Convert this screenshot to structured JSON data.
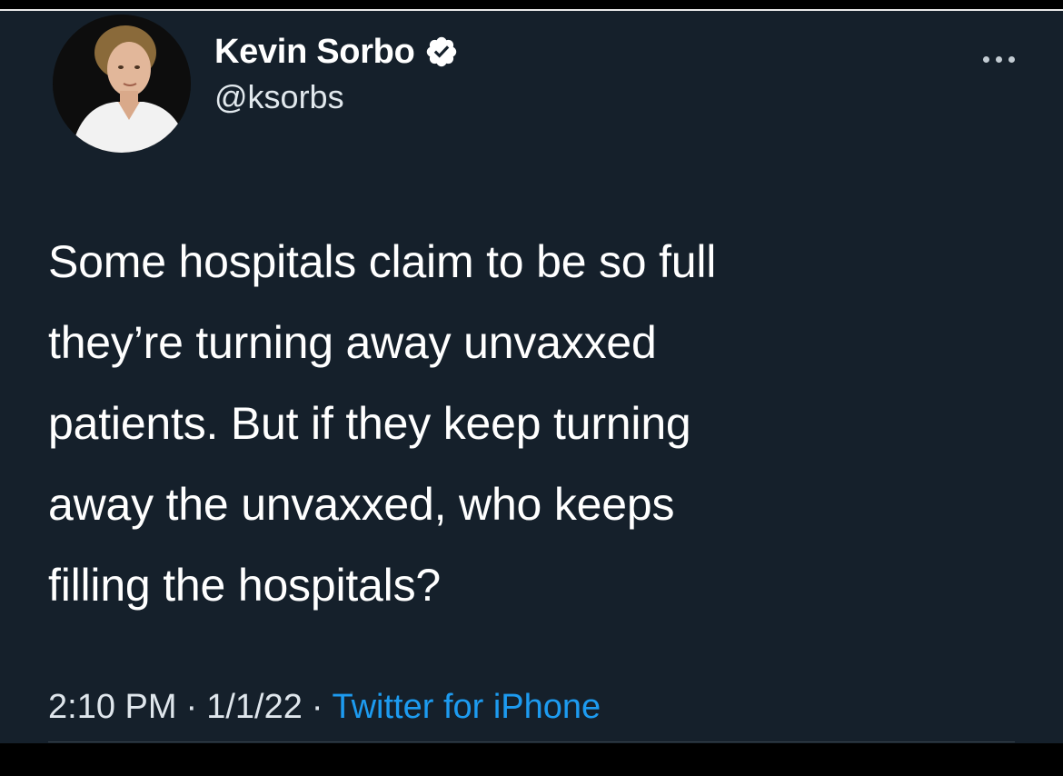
{
  "tweet": {
    "display_name": "Kevin Sorbo",
    "handle": "@ksorbs",
    "verified": true,
    "text": "Some hospitals claim to be so full\nthey’re turning away unvaxxed\npatients. But if they keep turning\naway the unvaxxed, who keeps\nfilling the hospitals?",
    "time": "2:10 PM",
    "date": "1/1/22",
    "separator": "·",
    "source": "Twitter for iPhone"
  },
  "icons": {
    "verified": "verified-badge-icon",
    "more": "more-horizontal-icon",
    "avatar": "profile-photo"
  },
  "colors": {
    "background": "#15202b",
    "text": "#ffffff",
    "secondary_text": "#dfe6ec",
    "link": "#1d9bf0"
  }
}
